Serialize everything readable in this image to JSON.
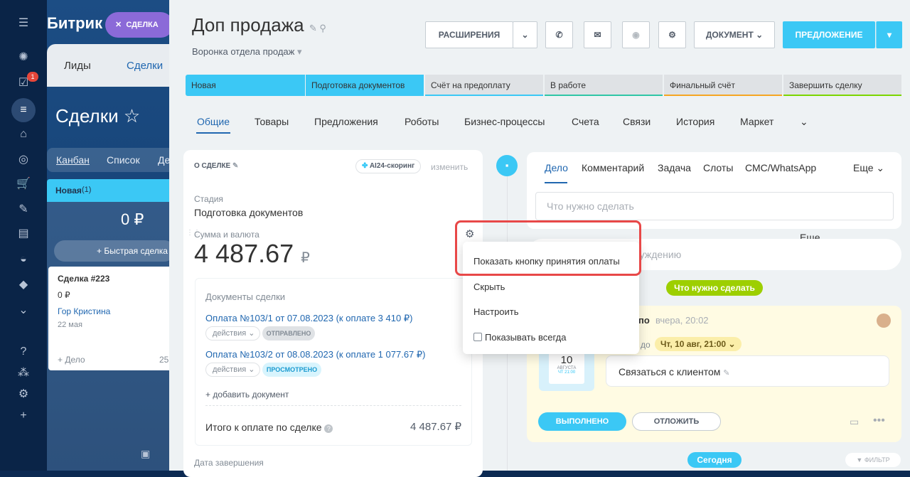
{
  "sidebar": {
    "badge": "1"
  },
  "bg": {
    "brand": "Битрик",
    "deal_chip": "СДЕЛКА",
    "tab1": "Лиды",
    "tab2": "Сделки",
    "title": "Сделки",
    "view1": "Канбан",
    "view2": "Список",
    "view3": "Де",
    "col_title": "Новая",
    "col_count": "(1)",
    "col_sum": "0 ₽",
    "quick_deal": "+ Быстрая сделка",
    "card_title": "Сделка #223",
    "card_sum": "0 ₽",
    "card_person": "Гор Кристина",
    "card_date": "22 мая",
    "card_add": "+ Дело",
    "card_num": "25"
  },
  "header": {
    "title": "Доп продажа",
    "funnel": "Воронка отдела продаж",
    "ext_label": "РАСШИРЕНИЯ",
    "doc_label": "ДОКУМЕНТ",
    "offer_label": "ПРЕДЛОЖЕНИЕ"
  },
  "stages": [
    "Новая",
    "Подготовка документов",
    "Счёт на предоплату",
    "В работе",
    "Финальный счёт",
    "Завершить сделку"
  ],
  "tabs": [
    "Общие",
    "Товары",
    "Предложения",
    "Роботы",
    "Бизнес-процессы",
    "Счета",
    "Связи",
    "История",
    "Маркет",
    "Еще"
  ],
  "about": {
    "title": "О СДЕЛКЕ",
    "scoring": "AI24-скоринг",
    "change": "изменить",
    "stage_label": "Стадия",
    "stage_value": "Подготовка документов",
    "sum_label": "Сумма и валюта",
    "sum_value": "4 487.67",
    "currency": "₽",
    "docs_title": "Документы сделки",
    "doc1": "Оплата №103/1 от 07.08.2023 (к оплате 3 410 ₽)",
    "doc1_actions": "действия",
    "doc1_status": "ОТПРАВЛЕНО",
    "doc2": "Оплата №103/2 от 08.08.2023 (к оплате 1 077.67 ₽)",
    "doc2_actions": "действия",
    "doc2_status": "ПРОСМОТРЕНО",
    "add_doc": "+ добавить документ",
    "total_label": "Итого к оплате по сделке",
    "total_value": "4 487.67 ₽",
    "end_label": "Дата завершения"
  },
  "menu": {
    "item1": "Показать кнопку принятия оплаты",
    "item2": "Скрыть",
    "item3": "Настроить",
    "item4": "Показывать всегда"
  },
  "activity": {
    "tabs": [
      "Дело",
      "Комментарий",
      "Задача",
      "Слоты",
      "СМС/WhatsApp"
    ],
    "more": "Еще",
    "todo_placeholder": "Что нужно сделать",
    "comment_placeholder": "...суждению",
    "todo_badge": "Что нужно сделать",
    "item_head": "по",
    "item_time": "вчера, 20:02",
    "due_prefix": "до",
    "due_date": "Чт, 10 авг, 21:00",
    "cal_day": "10",
    "cal_month": "АВГУСТА",
    "cal_time": "ЧТ 21:00",
    "task_text": "Связаться с клиентом",
    "done_btn": "ВЫПОЛНЕНО",
    "postpone_btn": "ОТЛОЖИТЬ",
    "today": "Сегодня",
    "filter": "ФИЛЬТР"
  }
}
